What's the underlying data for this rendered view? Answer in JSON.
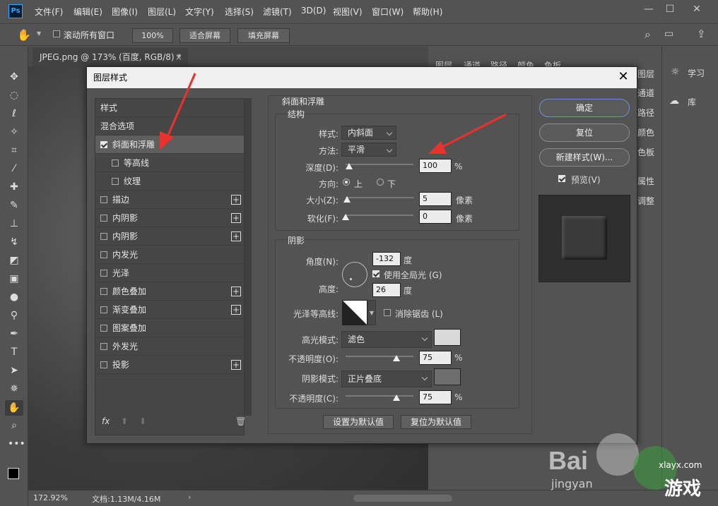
{
  "menu": {
    "logo": "Ps",
    "items": [
      "文件(F)",
      "编辑(E)",
      "图像(I)",
      "图层(L)",
      "文字(Y)",
      "选择(S)",
      "滤镜(T)",
      "3D(D)",
      "视图(V)",
      "窗口(W)",
      "帮助(H)"
    ]
  },
  "options": {
    "scroll_all": "滚动所有窗口",
    "zoom": "100%",
    "fit_screen": "适合屏幕",
    "fill_screen": "填充屏幕"
  },
  "document": {
    "tab_title": "JPEG.png @ 173% (百度, RGB/8) *"
  },
  "status": {
    "zoom": "172.92%",
    "doc_size": "文档:1.13M/4.16M"
  },
  "right_panel": {
    "tabs": [
      "图层",
      "通道",
      "路径",
      "颜色",
      "色板"
    ],
    "side_items": [
      "图层",
      "通道",
      "路径",
      "颜色",
      "色板",
      "属性",
      "调整"
    ],
    "learn": "学习",
    "library": "库"
  },
  "dialog": {
    "title": "图层样式",
    "list": {
      "header": "样式",
      "blend": "混合选项",
      "items": [
        {
          "label": "斜面和浮雕",
          "checked": true,
          "plus": false,
          "indent": 0
        },
        {
          "label": "等高线",
          "checked": false,
          "plus": false,
          "indent": 1
        },
        {
          "label": "纹理",
          "checked": false,
          "plus": false,
          "indent": 1
        },
        {
          "label": "描边",
          "checked": false,
          "plus": true,
          "indent": 0
        },
        {
          "label": "内阴影",
          "checked": false,
          "plus": true,
          "indent": 0
        },
        {
          "label": "内阴影",
          "checked": false,
          "plus": true,
          "indent": 0
        },
        {
          "label": "内发光",
          "checked": false,
          "plus": false,
          "indent": 0
        },
        {
          "label": "光泽",
          "checked": false,
          "plus": false,
          "indent": 0
        },
        {
          "label": "颜色叠加",
          "checked": false,
          "plus": true,
          "indent": 0
        },
        {
          "label": "渐变叠加",
          "checked": false,
          "plus": true,
          "indent": 0
        },
        {
          "label": "图案叠加",
          "checked": false,
          "plus": false,
          "indent": 0
        },
        {
          "label": "外发光",
          "checked": false,
          "plus": false,
          "indent": 0
        },
        {
          "label": "投影",
          "checked": false,
          "plus": true,
          "indent": 0
        }
      ],
      "fx": "fx"
    },
    "bevel": {
      "section": "斜面和浮雕",
      "structure": "结构",
      "style_label": "样式:",
      "style_value": "内斜面",
      "technique_label": "方法:",
      "technique_value": "平滑",
      "depth_label": "深度(D):",
      "depth_value": "100",
      "depth_level": 0.05,
      "percent": "%",
      "direction_label": "方向:",
      "direction_up": "上",
      "direction_down": "下",
      "size_label": "大小(Z):",
      "size_value": "5",
      "size_level": 0.02,
      "soften_label": "软化(F):",
      "soften_value": "0",
      "soften_level": 0,
      "px": "像素"
    },
    "shading": {
      "section": "阴影",
      "angle_label": "角度(N):",
      "angle_value": "-132",
      "degree": "度",
      "global_light": "使用全局光 (G)",
      "altitude_label": "高度:",
      "altitude_value": "26",
      "gloss_label": "光泽等高线:",
      "antialias": "消除锯齿 (L)",
      "highlight_mode_label": "高光模式:",
      "highlight_mode": "滤色",
      "highlight_color": "#d9d9d9",
      "highlight_opacity_label": "不透明度(O):",
      "highlight_opacity": "75",
      "highlight_level": 0.75,
      "shadow_mode_label": "阴影模式:",
      "shadow_mode": "正片叠底",
      "shadow_color": "#6e6e6e",
      "shadow_opacity_label": "不透明度(C):",
      "shadow_opacity": "75",
      "shadow_level": 0.75,
      "set_default": "设置为默认值",
      "reset_default": "复位为默认值"
    },
    "buttons": {
      "ok": "确定",
      "reset": "复位",
      "new_style": "新建样式(W)...",
      "preview": "预览(V)"
    }
  },
  "watermark": {
    "baidu": "Bai",
    "jingyan": "jingyan",
    "site": "xlayx.com",
    "game": "游戏"
  },
  "colors": {
    "annotation_arrow": "#e8322c",
    "accent_blue": "#6b8fd6"
  }
}
